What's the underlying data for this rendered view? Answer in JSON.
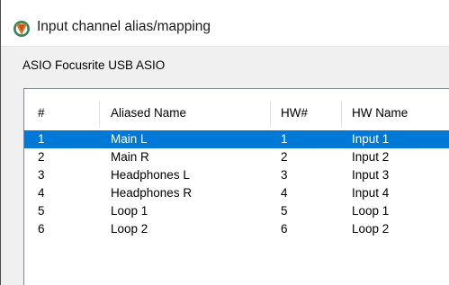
{
  "window": {
    "title": "Input channel alias/mapping"
  },
  "device_label": "ASIO Focusrite USB ASIO",
  "table": {
    "columns": [
      "#",
      "Aliased Name",
      "HW#",
      "HW Name"
    ],
    "rows": [
      {
        "num": "1",
        "alias": "Main L",
        "hw": "1",
        "hw_name": "Input 1",
        "selected": true
      },
      {
        "num": "2",
        "alias": "Main R",
        "hw": "2",
        "hw_name": "Input 2",
        "selected": false
      },
      {
        "num": "3",
        "alias": "Headphones L",
        "hw": "3",
        "hw_name": "Input 3",
        "selected": false
      },
      {
        "num": "4",
        "alias": "Headphones R",
        "hw": "4",
        "hw_name": "Input 4",
        "selected": false
      },
      {
        "num": "5",
        "alias": "Loop 1",
        "hw": "5",
        "hw_name": "Loop 1",
        "selected": false
      },
      {
        "num": "6",
        "alias": "Loop 2",
        "hw": "6",
        "hw_name": "Loop 2",
        "selected": false
      }
    ]
  },
  "colors": {
    "selection": "#0078d7",
    "app_icon_ring": "#2e8b57",
    "app_icon_center": "#e8732a"
  },
  "icons": {
    "app": "reaper-app-icon"
  }
}
